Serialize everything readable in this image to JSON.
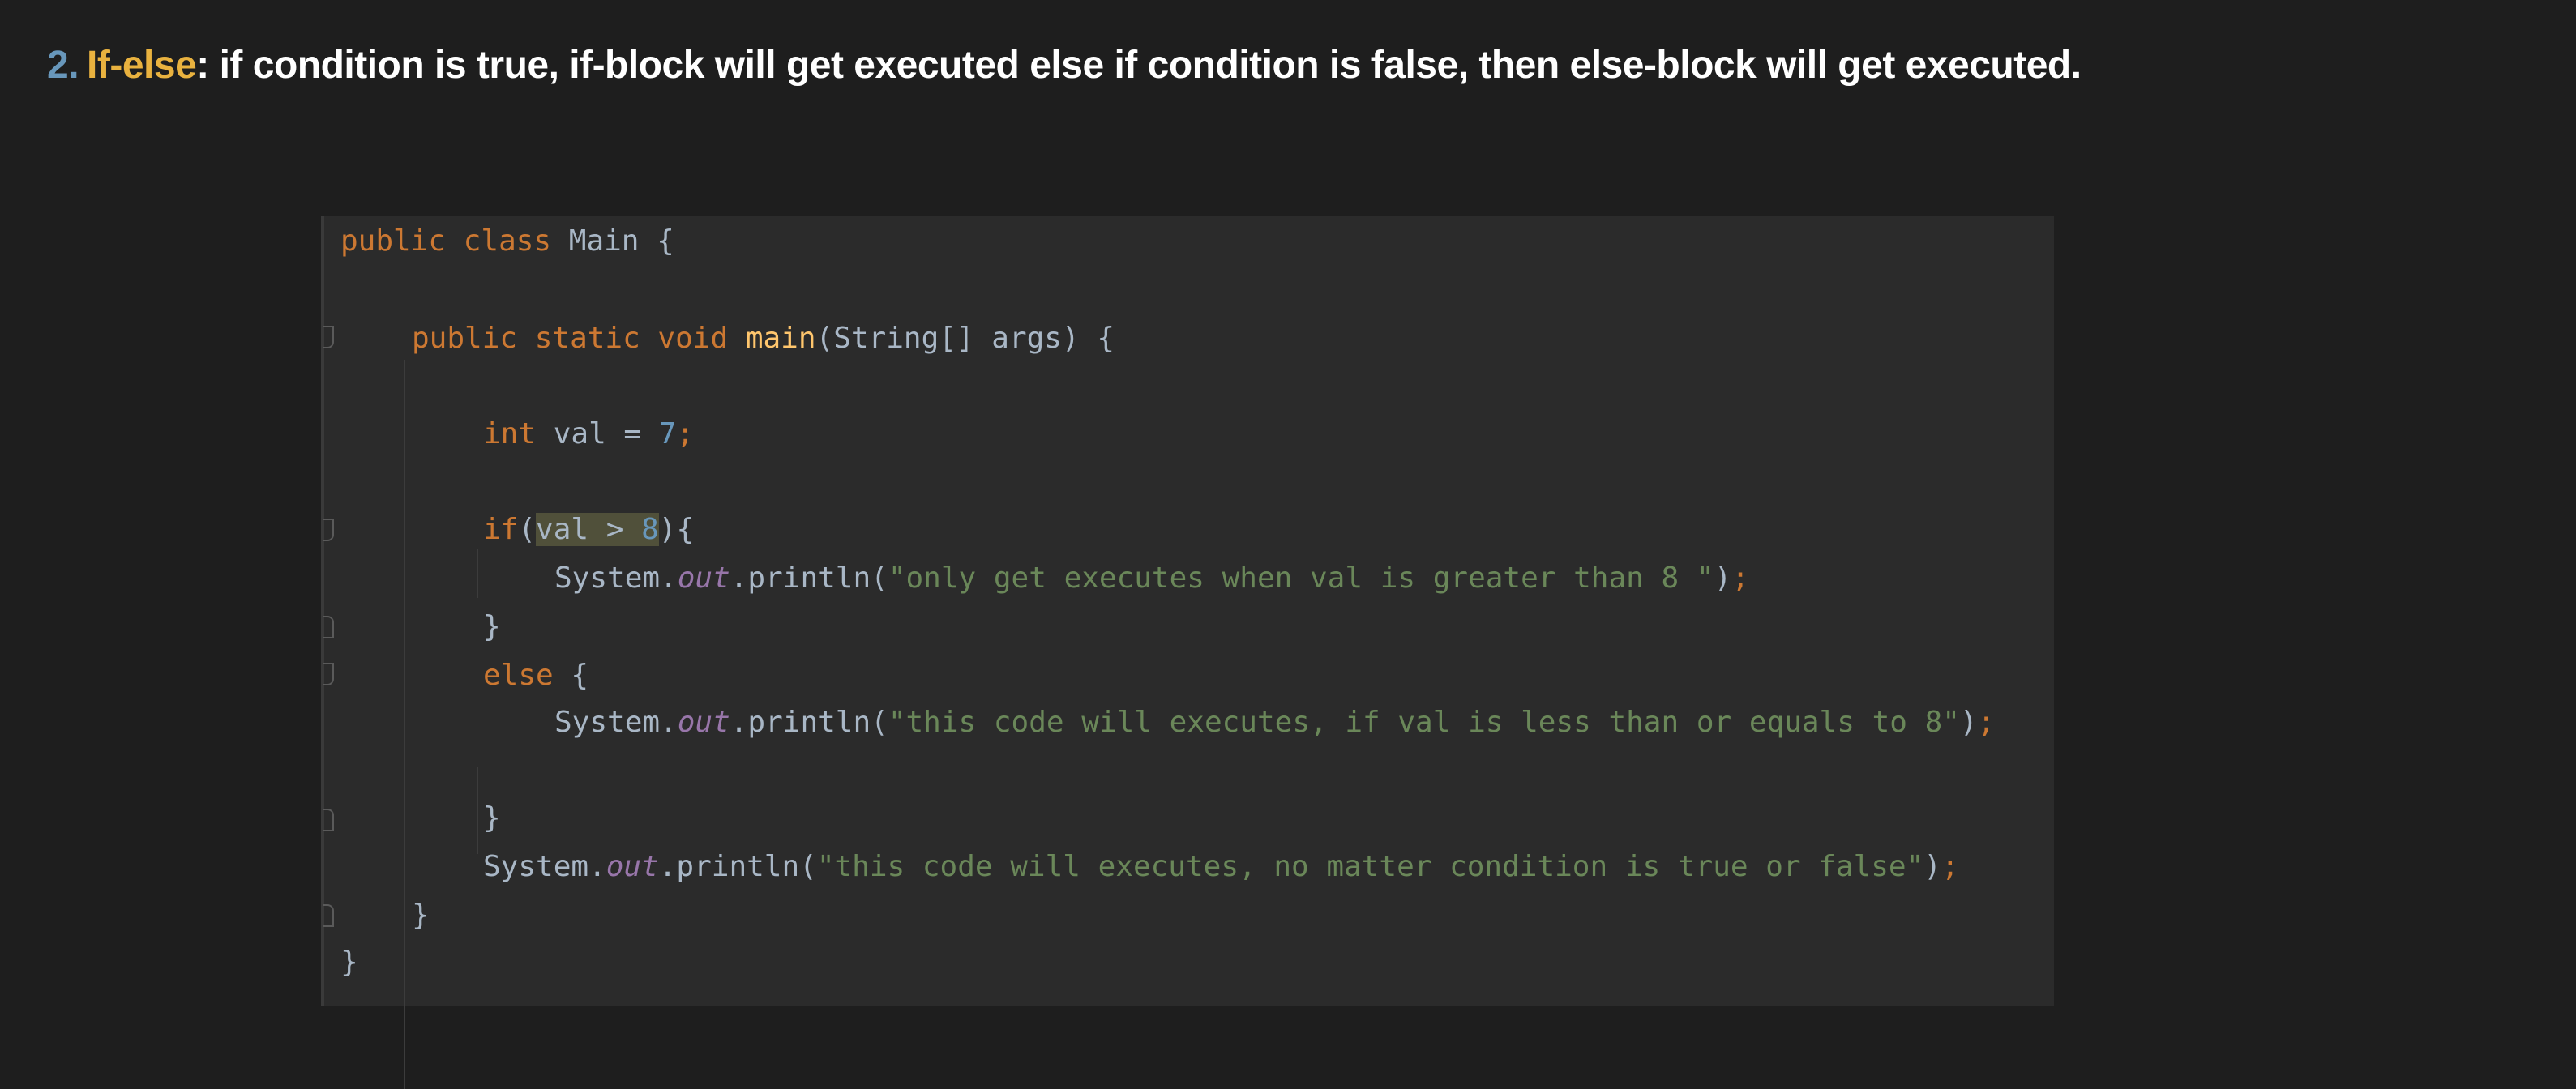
{
  "heading": {
    "number": "2.",
    "term": "If-else",
    "rest": ": if condition is true, if-block will get executed else if condition is false, then else-block will get executed."
  },
  "code": {
    "l1": {
      "kw": "public class",
      "name": "Main",
      "brace": "{"
    },
    "l2": {
      "kw": "public static void",
      "fn": "main",
      "args": "(String[] args) {"
    },
    "l3": {
      "kw": "int",
      "decl": "val =",
      "num": "7",
      "semi": ";"
    },
    "l4": {
      "kw": "if",
      "open": "(",
      "cond": "val > ",
      "num": "8",
      "close": "){"
    },
    "l5": {
      "obj": "System.",
      "field": "out",
      "call": ".println(",
      "str": "\"only get executes when val is greater than 8 \"",
      "end": ")",
      "semi": ";"
    },
    "l6": {
      "brace": "}"
    },
    "l7": {
      "kw": "else",
      "brace": "{"
    },
    "l8": {
      "obj": "System.",
      "field": "out",
      "call": ".println(",
      "str": "\"this code will executes, if val is less than or equals to 8\"",
      "end": ")",
      "semi": ";"
    },
    "l9": {
      "brace": "}"
    },
    "l10": {
      "obj": "System.",
      "field": "out",
      "call": ".println(",
      "str": "\"this code will executes, no matter condition is true or false\"",
      "end": ")",
      "semi": ";"
    },
    "l11": {
      "brace": "}"
    },
    "l12": {
      "brace": "}"
    }
  },
  "colors": {
    "background": "#1e1e1e",
    "editor": "#2b2b2b",
    "keyword": "#cc7832",
    "string": "#6a8759",
    "number": "#6897bb",
    "method": "#ffc66d",
    "field": "#9876aa",
    "text": "#a9b7c6",
    "highlight_term": "#e9b23f"
  }
}
